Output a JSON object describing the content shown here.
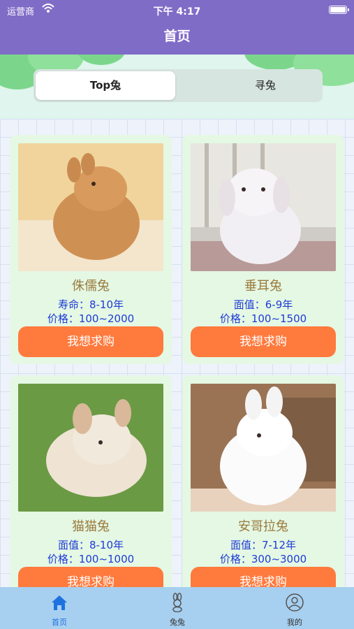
{
  "status_bar": {
    "carrier": "运营商",
    "time": "下午 4:17"
  },
  "nav": {
    "title": "首页"
  },
  "segments": {
    "active": "Top兔",
    "inactive": "寻兔"
  },
  "cards": [
    {
      "name": "侏儒兔",
      "line1": "寿命：8-10年",
      "line2": "价格：100~2000",
      "button": "我想求购"
    },
    {
      "name": "垂耳兔",
      "line1": "面值：6-9年",
      "line2": "价格：100~1500",
      "button": "我想求购"
    },
    {
      "name": "猫猫兔",
      "line1": "面值：8-10年",
      "line2": "价格：100~1000",
      "button": "我想求购"
    },
    {
      "name": "安哥拉兔",
      "line1": "面值：7-12年",
      "line2": "价格：300~3000",
      "button": "我想求购"
    }
  ],
  "tabs": [
    {
      "label": "首页",
      "icon": "home-icon",
      "active": true
    },
    {
      "label": "兔兔",
      "icon": "rabbit-icon",
      "active": false
    },
    {
      "label": "我的",
      "icon": "profile-icon",
      "active": false
    }
  ],
  "colors": {
    "nav": "#7f6cc7",
    "button": "#ff7a3d",
    "card": "#e4f8e4",
    "tabbar": "#a7cfef",
    "accent": "#1e72e0"
  }
}
